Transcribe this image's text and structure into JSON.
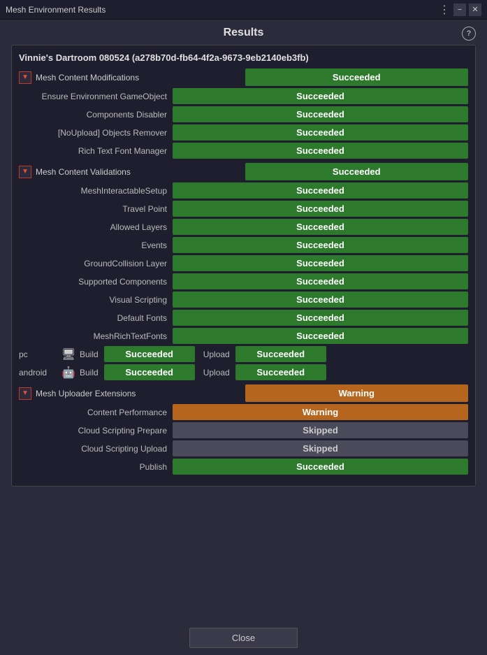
{
  "titleBar": {
    "title": "Mesh Environment Results",
    "dotsLabel": "⋮",
    "minimizeLabel": "−",
    "closeLabel": "✕"
  },
  "main": {
    "resultsTitle": "Results",
    "helpLabel": "?",
    "envTitle": "Vinnie's Dartroom 080524 (a278b70d-fb64-4f2a-9673-9eb2140eb3fb)",
    "sections": [
      {
        "id": "mesh-content-modifications",
        "label": "Mesh Content Modifications",
        "status": "Succeeded",
        "statusType": "green",
        "rows": [
          {
            "label": "Ensure Environment GameObject",
            "status": "Succeeded",
            "statusType": "green"
          },
          {
            "label": "Components Disabler",
            "status": "Succeeded",
            "statusType": "green"
          },
          {
            "label": "[NoUpload] Objects Remover",
            "status": "Succeeded",
            "statusType": "green"
          },
          {
            "label": "Rich Text Font Manager",
            "status": "Succeeded",
            "statusType": "green"
          }
        ]
      },
      {
        "id": "mesh-content-validations",
        "label": "Mesh Content Validations",
        "status": "Succeeded",
        "statusType": "green",
        "rows": [
          {
            "label": "MeshInteractableSetup",
            "status": "Succeeded",
            "statusType": "green"
          },
          {
            "label": "Travel Point",
            "status": "Succeeded",
            "statusType": "green"
          },
          {
            "label": "Allowed Layers",
            "status": "Succeeded",
            "statusType": "green"
          },
          {
            "label": "Events",
            "status": "Succeeded",
            "statusType": "green"
          },
          {
            "label": "GroundCollision Layer",
            "status": "Succeeded",
            "statusType": "green"
          },
          {
            "label": "Supported Components",
            "status": "Succeeded",
            "statusType": "green"
          },
          {
            "label": "Visual Scripting",
            "status": "Succeeded",
            "statusType": "green"
          },
          {
            "label": "Default Fonts",
            "status": "Succeeded",
            "statusType": "green"
          },
          {
            "label": "MeshRichTextFonts",
            "status": "Succeeded",
            "statusType": "green"
          }
        ],
        "platforms": [
          {
            "name": "pc",
            "icon": "🖥",
            "build": "Succeeded",
            "upload": "Succeeded"
          },
          {
            "name": "android",
            "icon": "📱",
            "build": "Succeeded",
            "upload": "Succeeded"
          }
        ]
      },
      {
        "id": "mesh-uploader-extensions",
        "label": "Mesh Uploader Extensions",
        "status": "Warning",
        "statusType": "orange",
        "rows": [
          {
            "label": "Content Performance",
            "status": "Warning",
            "statusType": "orange"
          },
          {
            "label": "Cloud Scripting Prepare",
            "status": "Skipped",
            "statusType": "gray"
          },
          {
            "label": "Cloud Scripting Upload",
            "status": "Skipped",
            "statusType": "gray"
          },
          {
            "label": "Publish",
            "status": "Succeeded",
            "statusType": "green"
          }
        ]
      }
    ],
    "closeLabel": "Close"
  }
}
